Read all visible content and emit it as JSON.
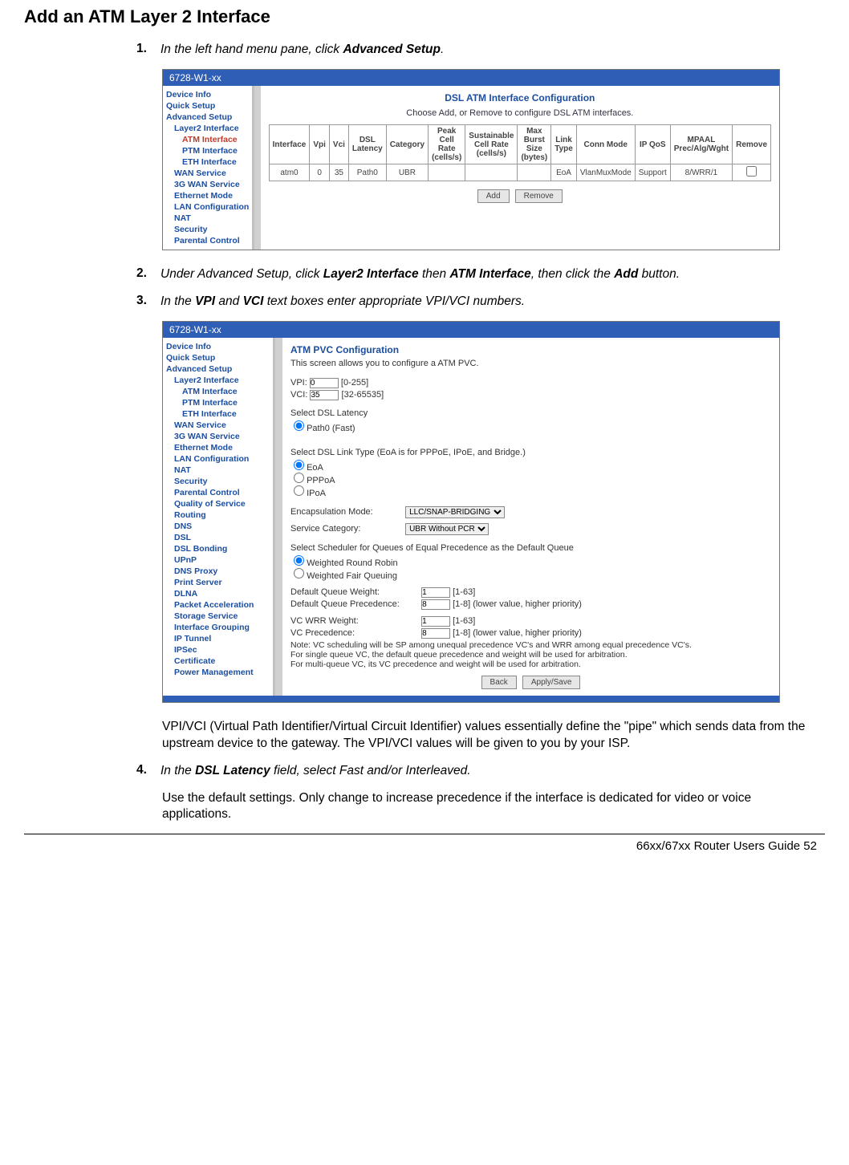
{
  "page": {
    "heading": "Add an ATM Layer 2 Interface",
    "footer": "66xx/67xx Router Users Guide    52"
  },
  "steps": {
    "s1_num": "1.",
    "s1_a": "In the left hand menu pane, click ",
    "s1_b": "Advanced Setup",
    "s1_c": ".",
    "s2_num": "2.",
    "s2_a": "Under Advanced Setup, click ",
    "s2_b": "Layer2 Interface",
    "s2_c": " then ",
    "s2_d": "ATM Interface",
    "s2_e": ", then click the ",
    "s2_f": "Add",
    "s2_g": " button.",
    "s3_num": "3.",
    "s3_a": "In the ",
    "s3_b": "VPI",
    "s3_c": " and ",
    "s3_d": "VCI",
    "s3_e": " text boxes enter appropriate VPI/VCI numbers.",
    "s4_num": "4.",
    "s4_a": "In the ",
    "s4_b": "DSL Latency",
    "s4_c": " field, select Fast and/or Interleaved."
  },
  "paragraphs": {
    "p_vpi": "VPI/VCI (Virtual Path Identifier/Virtual Circuit Identifier) values essentially define the \"pipe\" which sends data from the upstream device to the gateway. The VPI/VCI values will be given to you by your ISP.",
    "p_default": "Use the default settings. Only change to increase precedence if the interface is dedicated for video or voice applications."
  },
  "ss1": {
    "titlebar": "6728-W1-xx",
    "menu": {
      "device_info": "Device Info",
      "quick_setup": "Quick Setup",
      "advanced_setup": "Advanced Setup",
      "layer2": "Layer2 Interface",
      "atm": "ATM Interface",
      "ptm": "PTM Interface",
      "eth": "ETH Interface",
      "wan": "WAN Service",
      "g3wan": "3G WAN Service",
      "ethmode": "Ethernet Mode",
      "lan": "LAN Configuration",
      "nat": "NAT",
      "sec": "Security",
      "parental": "Parental Control"
    },
    "content": {
      "title": "DSL ATM Interface Configuration",
      "subtitle": "Choose Add, or Remove to configure DSL ATM interfaces.",
      "headers": {
        "interface": "Interface",
        "vpi": "Vpi",
        "vci": "Vci",
        "dsl_latency": "DSL Latency",
        "category": "Category",
        "peak": "Peak Cell Rate (cells/s)",
        "sustain": "Sustainable Cell Rate (cells/s)",
        "burst": "Max Burst Size (bytes)",
        "link": "Link Type",
        "conn": "Conn Mode",
        "qos": "IP QoS",
        "mpaal": "MPAAL Prec/Alg/Wght",
        "remove": "Remove"
      },
      "row": {
        "interface": "atm0",
        "vpi": "0",
        "vci": "35",
        "dsl_latency": "Path0",
        "category": "UBR",
        "peak": "",
        "sustain": "",
        "burst": "",
        "link": "EoA",
        "conn": "VlanMuxMode",
        "qos": "Support",
        "mpaal": "8/WRR/1"
      },
      "btn_add": "Add",
      "btn_remove": "Remove"
    }
  },
  "ss2": {
    "titlebar": "6728-W1-xx",
    "menu": {
      "device_info": "Device Info",
      "quick_setup": "Quick Setup",
      "advanced_setup": "Advanced Setup",
      "layer2": "Layer2 Interface",
      "atm": "ATM Interface",
      "ptm": "PTM Interface",
      "eth": "ETH Interface",
      "wan": "WAN Service",
      "g3wan": "3G WAN Service",
      "ethmode": "Ethernet Mode",
      "lan": "LAN Configuration",
      "nat": "NAT",
      "sec": "Security",
      "parental": "Parental Control",
      "qos": "Quality of Service",
      "routing": "Routing",
      "dns": "DNS",
      "dsl": "DSL",
      "bonding": "DSL Bonding",
      "upnp": "UPnP",
      "dnsproxy": "DNS Proxy",
      "print": "Print Server",
      "dlna": "DLNA",
      "packet": "Packet Acceleration",
      "storage": "Storage Service",
      "ifgroup": "Interface Grouping",
      "iptunnel": "IP Tunnel",
      "ipsec": "IPSec",
      "cert": "Certificate",
      "power": "Power Management"
    },
    "content": {
      "title": "ATM PVC Configuration",
      "desc": "This screen allows you to configure a ATM PVC.",
      "vpi_label": "VPI:",
      "vpi_val": "0",
      "vpi_range": "[0-255]",
      "vci_label": "VCI:",
      "vci_val": "35",
      "vci_range": "[32-65535]",
      "latency_label": "Select DSL Latency",
      "latency_opt": "Path0 (Fast)",
      "linktype_label": "Select DSL Link Type (EoA is for PPPoE, IPoE, and Bridge.)",
      "lt_eoa": "EoA",
      "lt_pppoa": "PPPoA",
      "lt_ipoa": "IPoA",
      "encap_label": "Encapsulation Mode:",
      "encap_val": "LLC/SNAP-BRIDGING",
      "service_label": "Service Category:",
      "service_val": "UBR Without PCR",
      "sched_label": "Select Scheduler for Queues of Equal Precedence as the Default Queue",
      "sched_wrr": "Weighted Round Robin",
      "sched_wfq": "Weighted Fair Queuing",
      "dqw_label": "Default Queue Weight:",
      "dqw_val": "1",
      "dqw_range": "[1-63]",
      "dqp_label": "Default Queue Precedence:",
      "dqp_val": "8",
      "dqp_range": "[1-8] (lower value, higher priority)",
      "vcw_label": "VC WRR Weight:",
      "vcw_val": "1",
      "vcw_range": "[1-63]",
      "vcp_label": "VC Precedence:",
      "vcp_val": "8",
      "vcp_range": "[1-8] (lower value, higher priority)",
      "note1": "Note: VC scheduling will be SP among unequal precedence VC's and WRR among equal precedence VC's.",
      "note2": "For single queue VC, the default queue precedence and weight will be used for arbitration.",
      "note3": "For multi-queue VC, its VC precedence and weight will be used for arbitration.",
      "btn_back": "Back",
      "btn_apply": "Apply/Save"
    }
  }
}
